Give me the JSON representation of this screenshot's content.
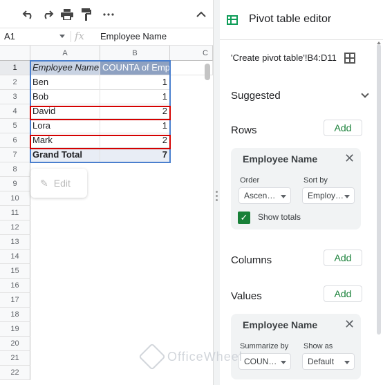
{
  "toolbar": {
    "icons": [
      "undo-icon",
      "redo-icon",
      "print-icon",
      "paint-format-icon",
      "more-icon",
      "collapse-icon"
    ]
  },
  "formula_bar": {
    "cell_ref": "A1",
    "fx": "fx",
    "content": "Employee Name"
  },
  "columns": [
    "A",
    "B",
    "C"
  ],
  "rows": [
    "1",
    "2",
    "3",
    "4",
    "5",
    "6",
    "7",
    "8",
    "9",
    "10",
    "11",
    "12",
    "13",
    "14",
    "15",
    "16",
    "17",
    "18",
    "19",
    "20",
    "21",
    "22"
  ],
  "table": {
    "header": [
      "Employee Name",
      "COUNTA of Emp"
    ],
    "data": [
      {
        "name": "Ben",
        "count": "1"
      },
      {
        "name": "Bob",
        "count": "1"
      },
      {
        "name": "David",
        "count": "2"
      },
      {
        "name": "Lora",
        "count": "1"
      },
      {
        "name": "Mark",
        "count": "2"
      }
    ],
    "total": {
      "label": "Grand Total",
      "value": "7"
    }
  },
  "edit_chip": {
    "label": "Edit"
  },
  "panel": {
    "title": "Pivot table editor",
    "range": "'Create pivot table'!B4:D11",
    "suggested": "Suggested",
    "rows_label": "Rows",
    "columns_label": "Columns",
    "values_label": "Values",
    "add_label": "Add",
    "rows_card": {
      "title": "Employee Name",
      "order_label": "Order",
      "order_value": "Ascen…",
      "sortby_label": "Sort by",
      "sortby_value": "Employ…",
      "show_totals": "Show totals"
    },
    "values_card": {
      "title": "Employee Name",
      "summarize_label": "Summarize by",
      "summarize_value": "COUN…",
      "showas_label": "Show as",
      "showas_value": "Default"
    }
  },
  "watermark": "OfficeWheel",
  "colors": {
    "accent_green": "#188038",
    "highlight_red": "#d40000",
    "pivot_header": "#8ea1c1"
  }
}
